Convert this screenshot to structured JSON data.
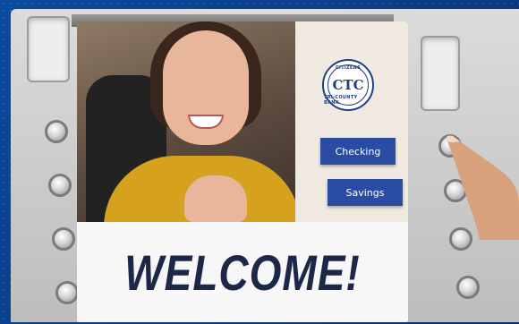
{
  "bank": {
    "logo_monogram": "CTC",
    "logo_text_top": "CITIZENS",
    "logo_text_bottom": "TRI-COUNTY BANK"
  },
  "menu": {
    "checking_label": "Checking",
    "savings_label": "Savings"
  },
  "screen": {
    "welcome_text": "WELCOME!"
  },
  "colors": {
    "button_blue": "#2a4ca3",
    "welcome_text": "#1d2748",
    "frame_blue": "#0b3a7a"
  }
}
